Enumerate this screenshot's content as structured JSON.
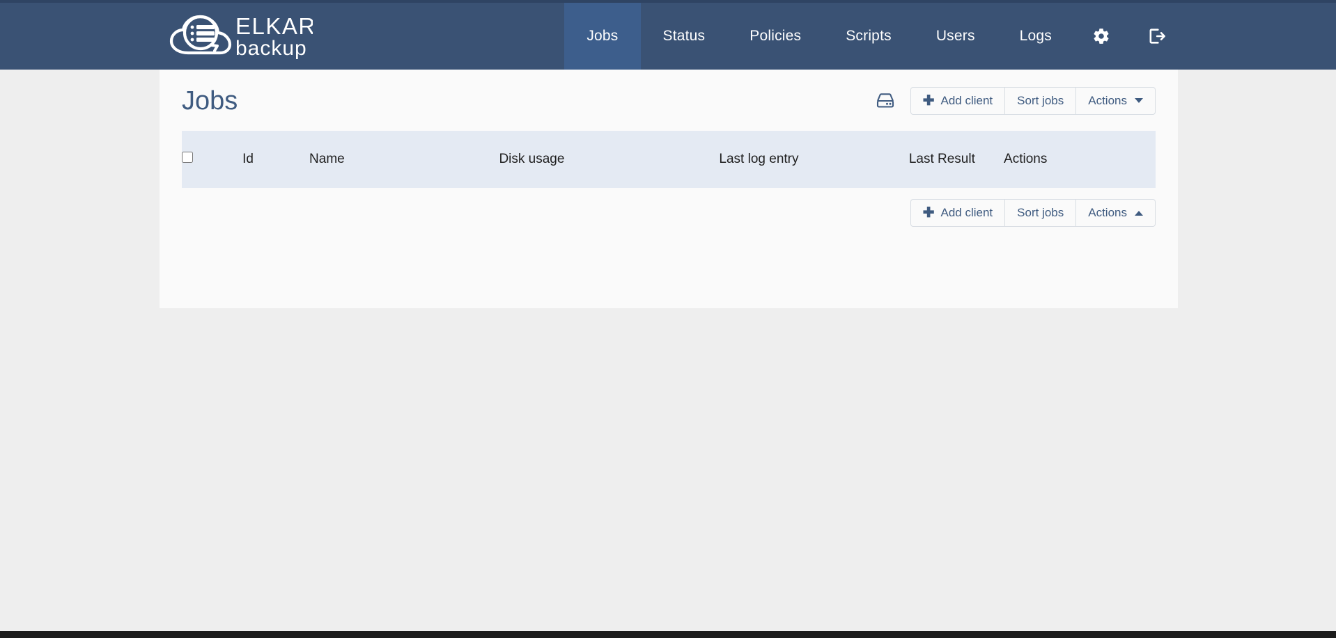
{
  "brand": {
    "name": "ELKAR",
    "subname": "backup",
    "logo_icon": "cloud-database-logo"
  },
  "nav": {
    "items": [
      {
        "label": "Jobs",
        "name": "nav-item-jobs",
        "active": true
      },
      {
        "label": "Status",
        "name": "nav-item-status",
        "active": false
      },
      {
        "label": "Policies",
        "name": "nav-item-policies",
        "active": false
      },
      {
        "label": "Scripts",
        "name": "nav-item-scripts",
        "active": false
      },
      {
        "label": "Users",
        "name": "nav-item-users",
        "active": false
      },
      {
        "label": "Logs",
        "name": "nav-item-logs",
        "active": false
      }
    ],
    "settings_icon": "gear-icon",
    "logout_icon": "sign-out-icon"
  },
  "page": {
    "title": "Jobs"
  },
  "toolbar_top": {
    "repository_icon": "hdd-icon",
    "add_client_label": "Add client",
    "sort_jobs_label": "Sort jobs",
    "actions_label": "Actions",
    "actions_caret": "down"
  },
  "toolbar_bottom": {
    "add_client_label": "Add client",
    "sort_jobs_label": "Sort jobs",
    "actions_label": "Actions",
    "actions_caret": "up"
  },
  "table": {
    "columns": [
      {
        "label": "",
        "key": "select"
      },
      {
        "label": "Id",
        "key": "id"
      },
      {
        "label": "Name",
        "key": "name"
      },
      {
        "label": "Disk usage",
        "key": "disk_usage"
      },
      {
        "label": "Last log entry",
        "key": "last_log"
      },
      {
        "label": "Last Result",
        "key": "last_result"
      },
      {
        "label": "Actions",
        "key": "actions"
      }
    ],
    "rows": [],
    "select_all_checked": false
  },
  "colors": {
    "navbar": "#3a5274",
    "navbar_active": "#3d5e8c",
    "page_bg": "#eeeeee",
    "card_bg": "#fafafa",
    "table_header_bg": "#e4eaf3",
    "accent_text": "#3f5b80",
    "bottom_bar": "#1c1c1c"
  }
}
